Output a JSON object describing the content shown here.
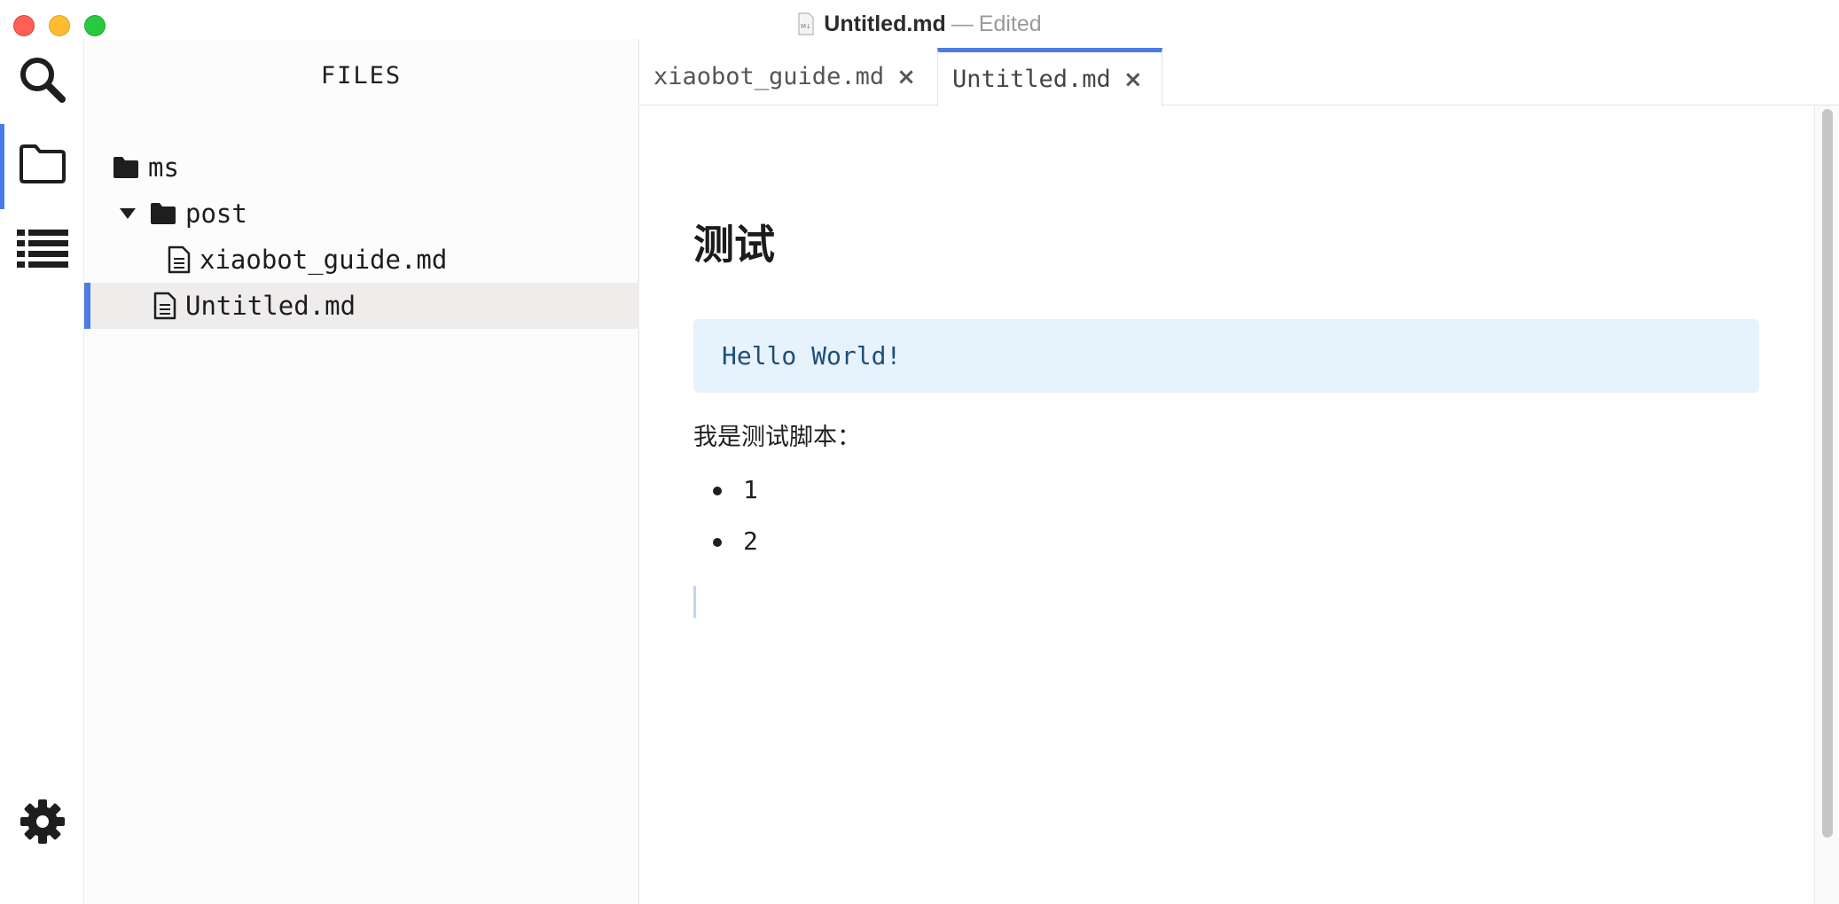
{
  "window": {
    "title": "Untitled.md",
    "separator": "—",
    "status": "Edited",
    "doc_icon": "markdown-doc-icon"
  },
  "activity_bar": {
    "items": [
      {
        "icon": "search-icon",
        "active": false
      },
      {
        "icon": "folder-icon",
        "active": true
      },
      {
        "icon": "list-icon",
        "active": false
      }
    ],
    "settings_icon": "gear-icon"
  },
  "sidebar": {
    "title": "FILES",
    "tree": [
      {
        "type": "folder",
        "label": "ms",
        "indent": 0,
        "expanded": false,
        "selected": false
      },
      {
        "type": "folder",
        "label": "post",
        "indent": 1,
        "expanded": true,
        "selected": false
      },
      {
        "type": "file",
        "label": "xiaobot_guide.md",
        "indent": 2,
        "selected": false
      },
      {
        "type": "file",
        "label": "Untitled.md",
        "indent": 1,
        "selected": true
      }
    ]
  },
  "tabs": [
    {
      "label": "xiaobot_guide.md",
      "close": "×",
      "active": false
    },
    {
      "label": "Untitled.md",
      "close": "×",
      "active": true
    }
  ],
  "document": {
    "heading": "测试",
    "code": "Hello World!",
    "paragraph": "我是测试脚本：",
    "list": [
      "1",
      "2"
    ]
  },
  "colors": {
    "accent": "#4b7be5",
    "code_bg": "#e6f2fc",
    "code_text": "#1f4e79",
    "selected_row": "#efecec"
  }
}
